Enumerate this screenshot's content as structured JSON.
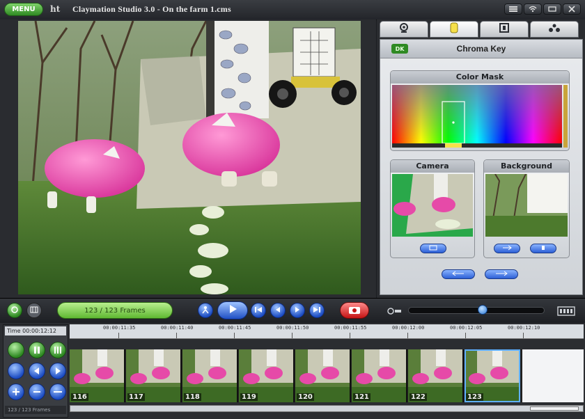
{
  "window": {
    "menu_label": "MENU",
    "logo": "ht",
    "title": "Claymation Studio 3.0  -  On the farm 1.cms"
  },
  "window_buttons": [
    "menu-icon",
    "wifi-icon",
    "minimize-icon",
    "close-icon"
  ],
  "side_tabs": [
    {
      "name": "camera-tab",
      "icon": "webcam-icon",
      "active": false
    },
    {
      "name": "chroma-tab",
      "icon": "color-key-icon",
      "active": true
    },
    {
      "name": "film-tab",
      "icon": "film-icon",
      "active": false
    },
    {
      "name": "effects-tab",
      "icon": "effects-icon",
      "active": false
    }
  ],
  "panel": {
    "badge": "DK",
    "title": "Chroma Key",
    "color_mask_title": "Color Mask",
    "camera_title": "Camera",
    "background_title": "Background"
  },
  "transport": {
    "frame_counter": "123 / 123 Frames"
  },
  "timeline": {
    "time_label": "Time 00:00:12:12",
    "status": "123 / 123 Frames",
    "ruler_ticks": [
      "00:00:11:35",
      "00:00:11:40",
      "00:00:11:45",
      "00:00:11:50",
      "00:00:11:55",
      "00:00:12:00",
      "00:00:12:05",
      "00:00:12:10"
    ],
    "frames": [
      "116",
      "117",
      "118",
      "119",
      "120",
      "121",
      "122",
      "123"
    ],
    "selected_frame": "123"
  },
  "colors": {
    "accent_green": "#5fb832",
    "accent_blue": "#2c5fd6",
    "record_red": "#c41414",
    "chroma_green": "#2aa84a"
  }
}
